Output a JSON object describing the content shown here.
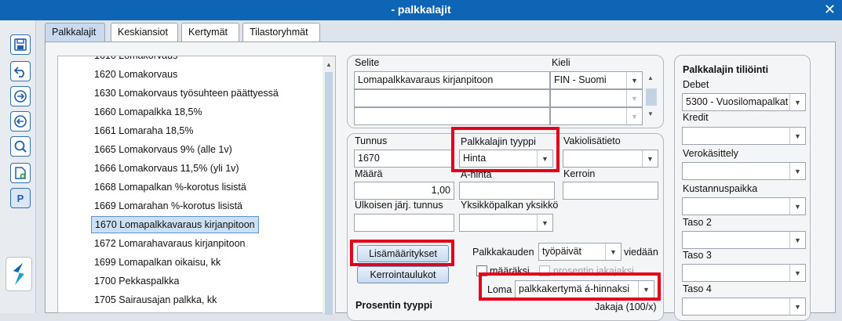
{
  "window": {
    "title": "- palkkalajit"
  },
  "tabs": [
    "Palkkalajit",
    "Keskiansiot",
    "Kertymät",
    "Tilastoryhmät"
  ],
  "toolbar": {
    "p_label": "P"
  },
  "list": {
    "items": [
      "1620 Lomakorvaus",
      "1630 Lomakorvaus työsuhteen päättyessä",
      "1660 Lomapalkka 18,5%",
      "1661 Lomaraha 18,5%",
      "1665 Lomakorvaus 9% (alle 1v)",
      "1666 Lomakorvaus 11,5% (yli 1v)",
      "1668 Lomapalkan %-korotus lisistä",
      "1669 Lomarahan %-korotus lisistä",
      "1670 Lomapalkkavaraus kirjanpitoon",
      "1672 Lomarahavaraus kirjanpitoon",
      "1699 Lomapalkan oikaisu, kk",
      "1700 Pekkaspalkka",
      "1705 Sairausajan palkka, kk"
    ],
    "selected": "1670 Lomapalkkavaraus kirjanpitoon"
  },
  "selite": {
    "label_selite": "Selite",
    "label_kieli": "Kieli",
    "value": "Lomapalkkavaraus kirjanpitoon",
    "kieli_value": "FIN - Suomi"
  },
  "details": {
    "tunnus_label": "Tunnus",
    "tunnus_value": "1670",
    "tyyppi_label": "Palkkalajin tyyppi",
    "tyyppi_value": "Hinta",
    "vakio_label": "Vakiolisätieto",
    "maara_label": "Määrä",
    "maara_value": "1,00",
    "ahinta_label": "A-hinta",
    "kerroin_label": "Kerroin",
    "ulkoisen_label": "Ulkoisen järj. tunnus",
    "yksikko_label": "Yksikköpalkan yksikkö",
    "lisamaaritykset_button": "Lisämääritykset",
    "kerrointaulukot_button": "Kerrointaulukot",
    "palkkakauden_label": "Palkkakauden",
    "palkkakauden_value": "työpäivät",
    "viedaan_label": "viedään",
    "maaraksi_label": "määräksi",
    "prosentin_jakajaksi_label": "prosentin jakajaksi",
    "loma_label": "Loma",
    "loma_value": "palkkakertymä á-hinnaksi",
    "prosentin_tyyppi_label": "Prosentin tyyppi",
    "jakaja_label": "Jakaja (100/x)"
  },
  "tilointi": {
    "title": "Palkkalajin tiliöinti",
    "debet_label": "Debet",
    "debet_value": "5300 - Vuosilomapalkat",
    "kredit_label": "Kredit",
    "verokasittely_label": "Verokäsittely",
    "kustannuspaikka_label": "Kustannuspaikka",
    "taso2_label": "Taso 2",
    "taso3_label": "Taso 3",
    "taso4_label": "Taso 4"
  },
  "colors": {
    "titlebar": "#0f65b5",
    "highlight": "#e3001b",
    "selected_row": "#cce0f5"
  }
}
